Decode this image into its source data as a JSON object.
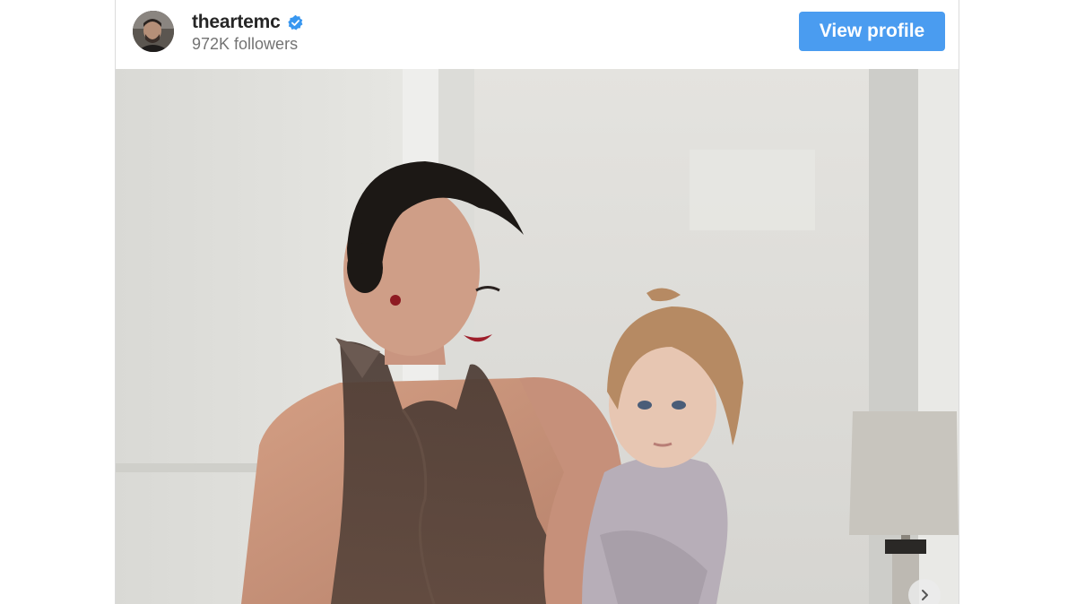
{
  "post_header": {
    "username": "theartemc",
    "verified": true,
    "followers": "972K followers",
    "view_profile_label": "View profile"
  },
  "colors": {
    "button_blue": "#4a9cf0",
    "verified_blue": "#3897f0",
    "username_text": "#262626",
    "secondary_text": "#737373"
  },
  "icons": {
    "verified": "verified-badge-icon",
    "next": "chevron-right-icon"
  },
  "media": {
    "type": "photo",
    "subject": "woman in sheer brown halter dress holding a toddler in a lilac outfit"
  }
}
